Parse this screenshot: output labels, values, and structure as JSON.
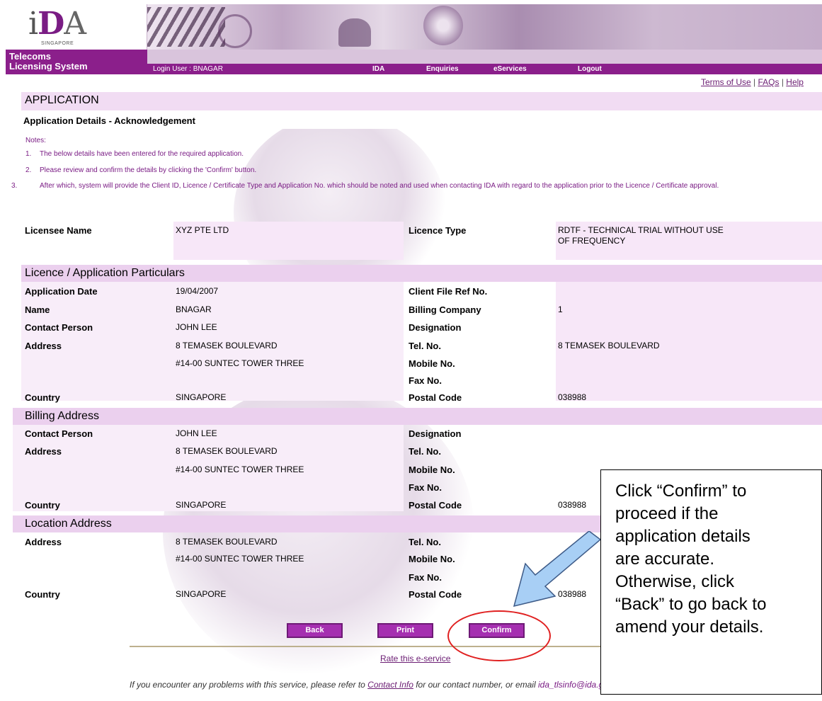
{
  "header": {
    "logo": {
      "i": "i",
      "d": "D",
      "a": "A",
      "sub": "SINGAPORE"
    },
    "system_title_line1": "Telecoms",
    "system_title_line2": "Licensing System",
    "login_user": "Login User : BNAGAR",
    "nav": [
      "IDA",
      "Enquiries",
      "eServices",
      "Logout"
    ]
  },
  "top_links": {
    "terms": "Terms of Use",
    "sep1": " | ",
    "faqs": "FAQs",
    "sep2": " | ",
    "help": "Help"
  },
  "page": {
    "heading": "APPLICATION",
    "subheading": "Application Details - Acknowledgement",
    "notes_title": "Notes:",
    "notes": [
      "The below details have been entered for the required application.",
      "Please review and confirm the details by clicking the 'Confirm' button.",
      "After which, system will provide the Client ID, Licence / Certificate Type and Application No. which should be noted and used when contacting IDA with regard to the application prior to the Licence / Certificate approval."
    ],
    "note_nums": [
      "1.",
      "2.",
      "3."
    ]
  },
  "licensee": {
    "name_label": "Licensee Name",
    "name_value": "XYZ PTE LTD",
    "type_label": "Licence Type",
    "type_value_1": "RDTF - TECHNICAL TRIAL WITHOUT USE",
    "type_value_2": "OF FREQUENCY"
  },
  "particulars": {
    "title": "Licence / Application Particulars",
    "application_date_label": "Application Date",
    "application_date": "19/04/2007",
    "client_file_label": "Client File Ref No.",
    "client_file": "",
    "name_label": "Name",
    "name": "BNAGAR",
    "billing_company_label": "Billing Company",
    "billing_company": "1",
    "contact_person_label": "Contact Person",
    "contact_person": "JOHN LEE",
    "designation_label": "Designation",
    "designation": "",
    "address_label": "Address",
    "address_1": "8 TEMASEK BOULEVARD",
    "address_2": "#14-00 SUNTEC TOWER THREE",
    "tel_label": "Tel. No.",
    "tel": "8 TEMASEK BOULEVARD",
    "mobile_label": "Mobile No.",
    "mobile": "",
    "fax_label": "Fax No.",
    "fax": "",
    "country_label": "Country",
    "country": "SINGAPORE",
    "postal_label": "Postal Code",
    "postal": "038988"
  },
  "billing": {
    "title": "Billing Address",
    "contact_person_label": "Contact Person",
    "contact_person": "JOHN LEE",
    "designation_label": "Designation",
    "address_label": "Address",
    "address_1": "8 TEMASEK BOULEVARD",
    "address_2": "#14-00 SUNTEC TOWER THREE",
    "tel_label": "Tel. No.",
    "mobile_label": "Mobile No.",
    "fax_label": "Fax No.",
    "country_label": "Country",
    "country": "SINGAPORE",
    "postal_label": "Postal Code",
    "postal": "038988"
  },
  "location": {
    "title": "Location Address",
    "address_label": "Address",
    "address_1": "8 TEMASEK BOULEVARD",
    "address_2": "#14-00 SUNTEC TOWER THREE",
    "tel_label": "Tel. No.",
    "mobile_label": "Mobile No.",
    "fax_label": "Fax No.",
    "country_label": "Country",
    "country": "SINGAPORE",
    "postal_label": "Postal Code",
    "postal": "038988"
  },
  "buttons": {
    "back": "Back",
    "print": "Print",
    "confirm": "Confirm"
  },
  "footer": {
    "rate": "Rate this e-service",
    "problem_text": "If you encounter any problems with this service, please refer to ",
    "contact_link": "Contact Info",
    "problem_text_2": " for our contact number, or email ",
    "email": "ida_tlsinfo@ida.gov.sg"
  },
  "callout": {
    "text_lines": [
      "Click “Confirm” to",
      "proceed if the",
      "application details",
      "are accurate.",
      "Otherwise, click",
      "“Back” to go back to",
      "amend your details."
    ]
  },
  "colors": {
    "brand_purple": "#8b1f8b",
    "band_lavender": "#f1dcf3",
    "button_purple": "#a52fb0",
    "callout_arrow": "#a8cff5",
    "highlight_circle": "#e02020"
  }
}
